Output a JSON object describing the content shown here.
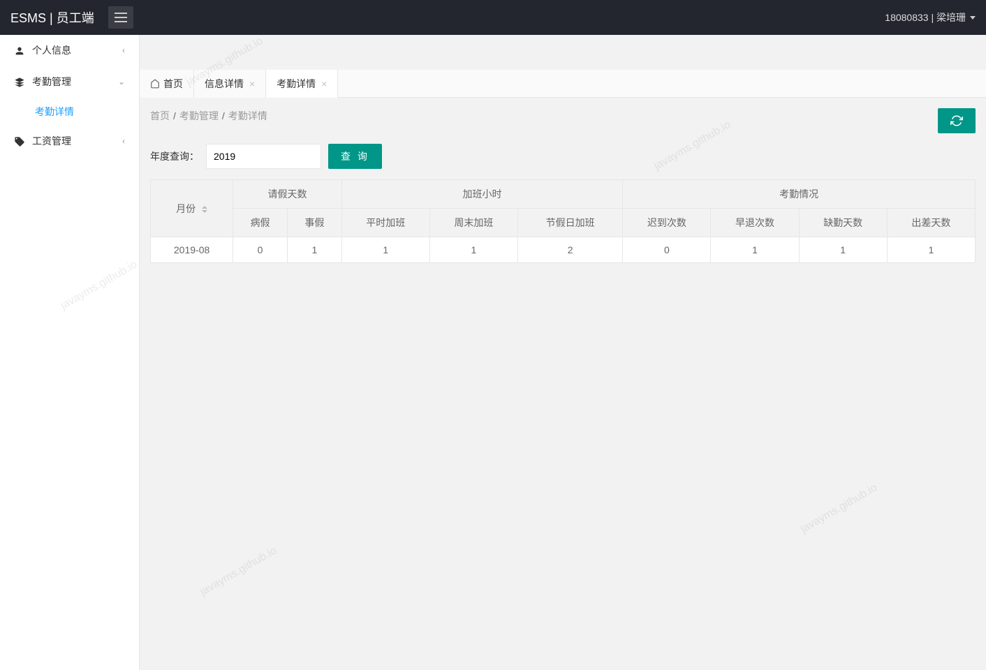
{
  "header": {
    "logo": "ESMS | 员工端",
    "user": "18080833 | 梁培珊"
  },
  "sidebar": {
    "items": [
      {
        "label": "个人信息",
        "icon": "user"
      },
      {
        "label": "考勤管理",
        "icon": "layers",
        "expanded": true,
        "sub": [
          {
            "label": "考勤详情"
          }
        ]
      },
      {
        "label": "工资管理",
        "icon": "tag"
      }
    ]
  },
  "tabs": [
    {
      "label": "首页",
      "home": true
    },
    {
      "label": "信息详情",
      "closable": true
    },
    {
      "label": "考勤详情",
      "closable": true,
      "active": true
    }
  ],
  "breadcrumb": [
    "首页",
    "考勤管理",
    "考勤详情"
  ],
  "query": {
    "label": "年度查询：",
    "value": "2019",
    "button": "查 询"
  },
  "table": {
    "header_row1": [
      {
        "label": "月份",
        "colspan": 1,
        "rowspan": 2,
        "sortable": true
      },
      {
        "label": "请假天数",
        "colspan": 2
      },
      {
        "label": "加班小时",
        "colspan": 3
      },
      {
        "label": "考勤情况",
        "colspan": 4
      }
    ],
    "header_row2": [
      "病假",
      "事假",
      "平时加班",
      "周末加班",
      "节假日加班",
      "迟到次数",
      "早退次数",
      "缺勤天数",
      "出差天数"
    ],
    "rows": [
      [
        "2019-08",
        "0",
        "1",
        "1",
        "1",
        "2",
        "0",
        "1",
        "1",
        "1"
      ]
    ]
  },
  "watermark": "javayms.github.io"
}
